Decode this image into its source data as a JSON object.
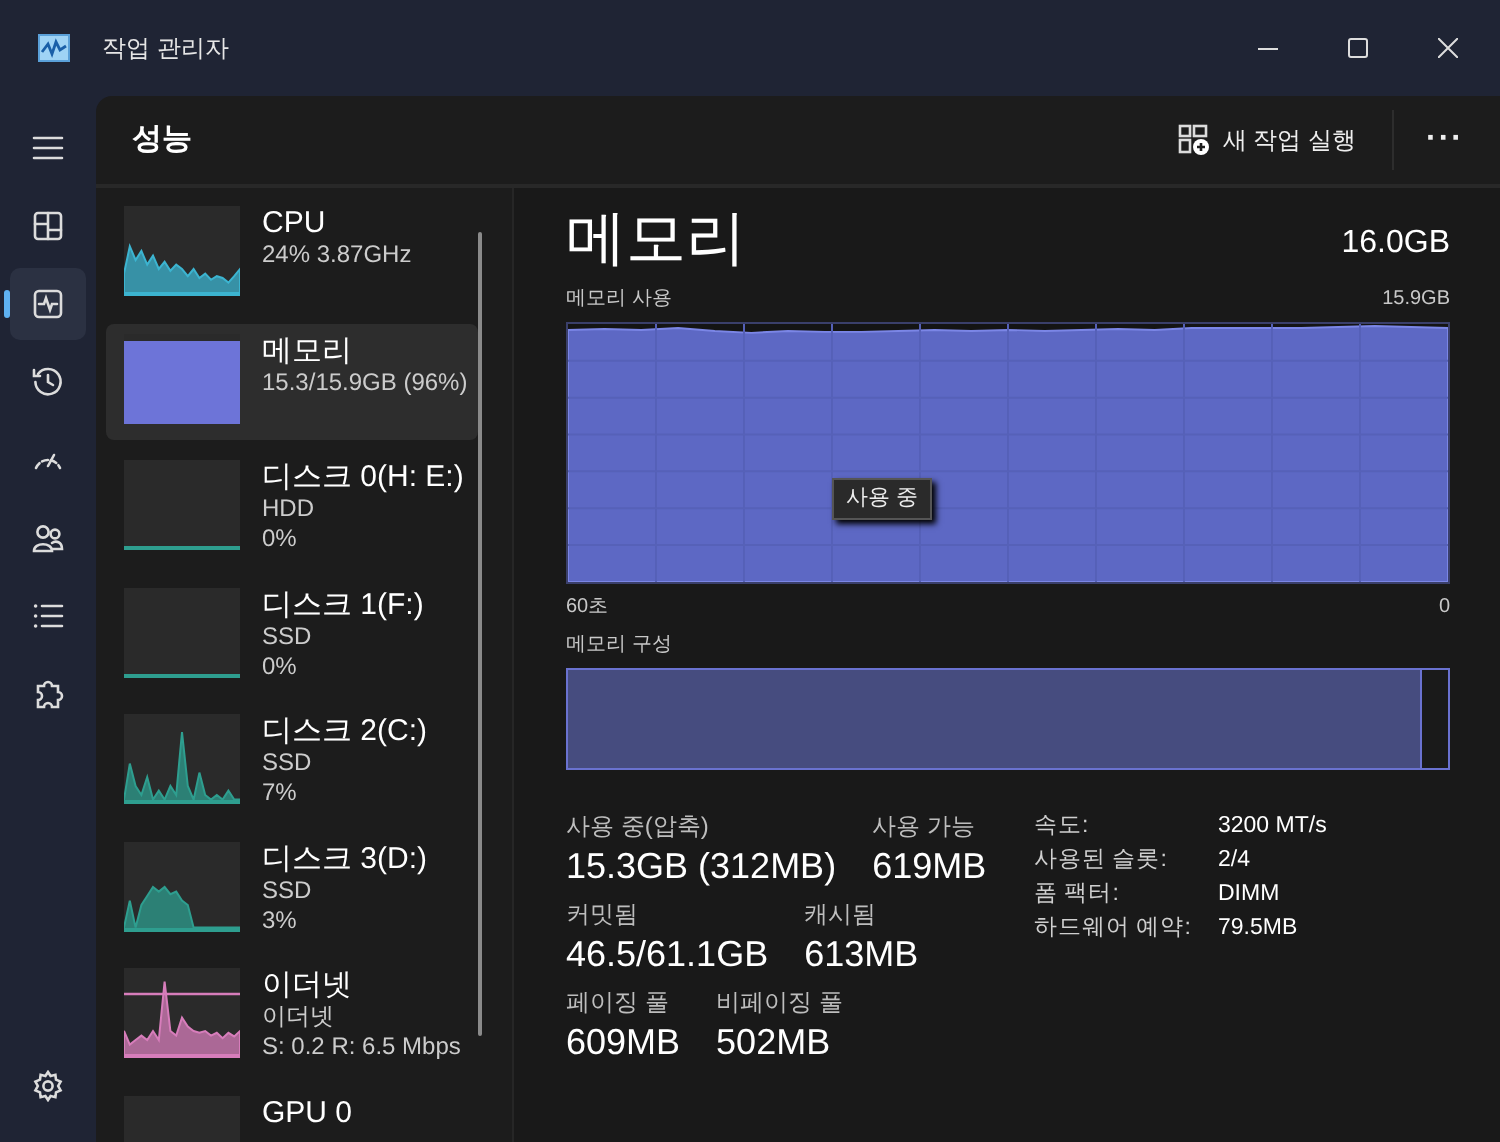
{
  "window": {
    "title": "작업 관리자"
  },
  "nav": [
    {
      "kind": "menu",
      "selected": false
    },
    {
      "kind": "processes",
      "selected": false
    },
    {
      "kind": "performance",
      "selected": true
    },
    {
      "kind": "history",
      "selected": false
    },
    {
      "kind": "startup",
      "selected": false
    },
    {
      "kind": "users",
      "selected": false
    },
    {
      "kind": "details",
      "selected": false
    },
    {
      "kind": "services",
      "selected": false
    },
    {
      "kind": "settings",
      "selected": false
    }
  ],
  "header": {
    "title": "성능",
    "new_task": "새 작업 실행",
    "more": "···"
  },
  "devices": [
    {
      "name": "CPU",
      "lines": [
        "24% 3.87GHz"
      ],
      "kind": "cpu",
      "color": "#3cb4d0",
      "selected": false
    },
    {
      "name": "메모리",
      "lines": [
        "15.3/15.9GB (96%)"
      ],
      "kind": "full",
      "color": "#6d74d8",
      "selected": true
    },
    {
      "name": "디스크 0(H: E:)",
      "lines": [
        "HDD",
        "0%"
      ],
      "kind": "empty",
      "color": "#2e9e8f",
      "selected": false
    },
    {
      "name": "디스크 1(F:)",
      "lines": [
        "SSD",
        "0%"
      ],
      "kind": "empty",
      "color": "#2e9e8f",
      "selected": false
    },
    {
      "name": "디스크 2(C:)",
      "lines": [
        "SSD",
        "7%"
      ],
      "kind": "spiky",
      "color": "#2e9e8f",
      "selected": false
    },
    {
      "name": "디스크 3(D:)",
      "lines": [
        "SSD",
        "3%"
      ],
      "kind": "hump",
      "color": "#2e9e8f",
      "selected": false
    },
    {
      "name": "이더넷",
      "lines": [
        "이더넷",
        "S: 0.2 R: 6.5 Mbps"
      ],
      "kind": "network",
      "color": "#d77dbb",
      "selected": false
    },
    {
      "name": "GPU 0",
      "kind": "empty",
      "selected": false
    }
  ],
  "detail": {
    "title": "메모리",
    "total": "16.0GB",
    "usage_label": "메모리 사용",
    "usage_max": "15.9GB",
    "time_start": "60초",
    "time_end": "0",
    "tooltip": "사용 중",
    "composition_label": "메모리 구성",
    "composition": {
      "level": 0.97
    },
    "stats": [
      [
        {
          "label": "사용 중(압축)",
          "value": "15.3GB (312MB)"
        },
        {
          "label": "사용 가능",
          "value": "619MB"
        }
      ],
      [
        {
          "label": "커밋됨",
          "value": "46.5/61.1GB"
        },
        {
          "label": "캐시됨",
          "value": "613MB"
        }
      ],
      [
        {
          "label": "페이징 풀",
          "value": "609MB"
        },
        {
          "label": "비페이징 풀",
          "value": "502MB"
        }
      ]
    ],
    "info": [
      {
        "label": "속도:",
        "value": "3200 MT/s"
      },
      {
        "label": "사용된 슬롯:",
        "value": "2/4"
      },
      {
        "label": "폼 팩터:",
        "value": "DIMM"
      },
      {
        "label": "하드웨어 예약:",
        "value": "79.5MB"
      }
    ]
  }
}
